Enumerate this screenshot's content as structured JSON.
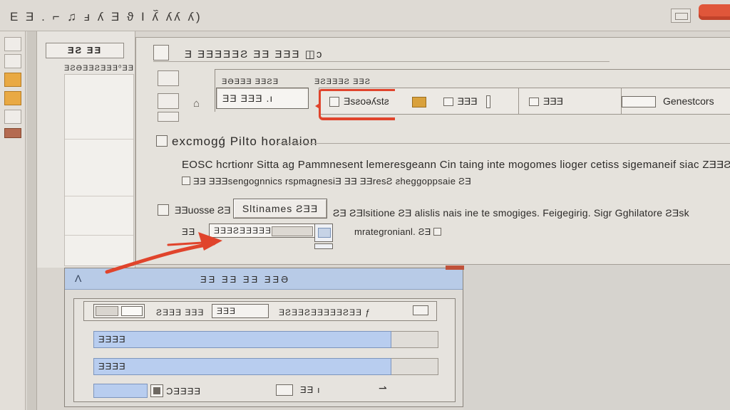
{
  "window": {
    "title": "E  Ǝ .  ⌐  ♫ ⅎ ʎ  Ǝ ϑ Ι  ʎ᷈ ʎʎ ʎ)"
  },
  "sidebar": {
    "header_label": "ƎƧ ƎƎ",
    "sub_label": "ƎƧƏƎƎƧƎƎƎ⁰ƎƎ"
  },
  "dialog": {
    "header": "Ǝ ƎƎƎƎƎƧ ƎƎ  ƎƎƎ ◫ɔ",
    "top_small_left": "ƎƏƎƎƎ ƎƎƧƎ",
    "top_small_right": "ƎƧƎƎƎƧ ƎƎƧ",
    "main_field": "ƎƎ ƎƎƎ .ı",
    "strip_selected": "Ǝsƨoǝʎstƨ",
    "strip_second": "ƎƎƎ",
    "strip_third": "ƎƎƎ",
    "strip_last": "Genestcors",
    "section_title": "excmogǵ  Pilto horalaion",
    "description": "EOSC hcrtionr  Sitta ag  Pammnesent lemeresgeann  Cin taing  inte mogomes  lioger cetiss  sigemaneif  siac  ZƎƎƧ",
    "description_2": "ƎƎ  ƎƎƎsengognnics rspmagnesiƎ  ƎƎ  ƎƎresƧ ƨheggoppsaie    ƧƎ",
    "option_label": "ƎƎuosse ƧƎ",
    "primary_button": "Sltinames ƧƎƎ",
    "option_text": "ƧƎ  ƧƎlsitione  ƧƎ  alislis  nais ine  te smogiges.  Feigegirig.  Sigr  Gghilatore  ƧƎsk",
    "path_label": "ƎƎ",
    "path_field": "ƎƎƎƧƎƎƎƎƎƎ",
    "path_hint": "mrategronianl.  ƧƎ"
  },
  "dialog2": {
    "title": "ƎƎ ƎƎ ƎƎ ƎƎƏ",
    "title_icon": "Ʌ",
    "field_a": "ƧƎƎƎ ƎƎƎ",
    "field_b": "ƎƎƎ",
    "field_c": "ƎƧƎƎƧƎƎƎƎƎƧƎƎ ƒ",
    "row_blue_1": "ƎƎƎƎ",
    "row_blue_2": "ƎƎƎƎ",
    "bottom_text": "ƆƎƎƎƎ",
    "bottom_step": "ƎƎ ı"
  },
  "colors": {
    "accent_red": "#e0442c",
    "selection_blue": "#b8cdef",
    "titlebar_blue": "#b8cbe7"
  }
}
